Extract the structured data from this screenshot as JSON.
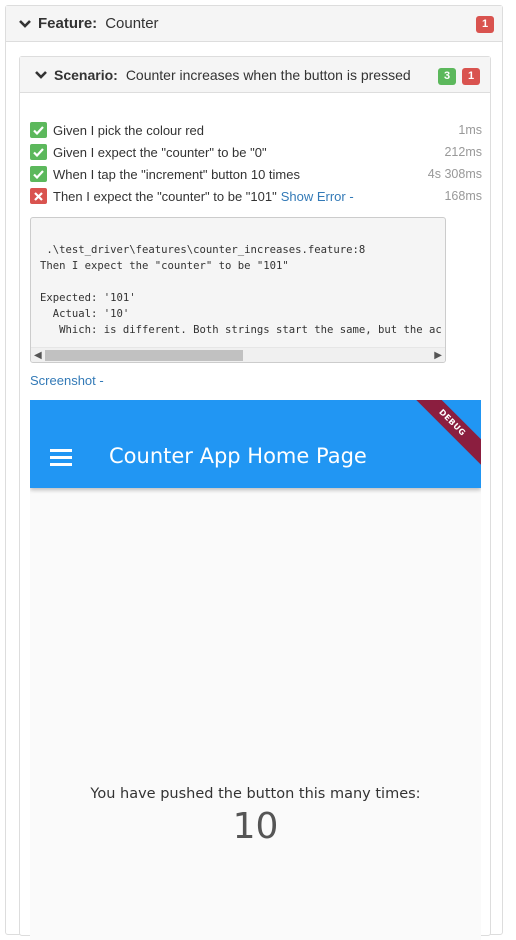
{
  "feature": {
    "keyword": "Feature:",
    "name": "Counter",
    "fail_count": "1"
  },
  "scenario": {
    "keyword": "Scenario:",
    "name": "Counter increases when the button is pressed",
    "pass_count": "3",
    "fail_count": "1"
  },
  "steps": [
    {
      "text": "Given I pick the colour red",
      "duration": "1ms",
      "status": "pass"
    },
    {
      "text": "Given I expect the \"counter\" to be \"0\"",
      "duration": "212ms",
      "status": "pass"
    },
    {
      "text": "When I tap the \"increment\" button 10 times",
      "duration": "4s 308ms",
      "status": "pass"
    },
    {
      "text": "Then I expect the \"counter\" to be \"101\"",
      "duration": "168ms",
      "status": "fail"
    }
  ],
  "show_error_label": "Show Error -",
  "error": {
    "text": " .\\test_driver\\features\\counter_increases.feature:8\nThen I expect the \"counter\" to be \"101\"\n\nExpected: '101'\n  Actual: '10'\n   Which: is different. Both strings start the same, but the ac"
  },
  "screenshot_label": "Screenshot -",
  "app": {
    "title": "Counter App Home Page",
    "debug_banner": "DEBUG",
    "pushed_text": "You have pushed the button this many times:",
    "counter_value": "10"
  },
  "colors": {
    "pass": "#5cb85c",
    "fail": "#d9534f",
    "link": "#337ab7",
    "appbar": "#2196f3"
  }
}
